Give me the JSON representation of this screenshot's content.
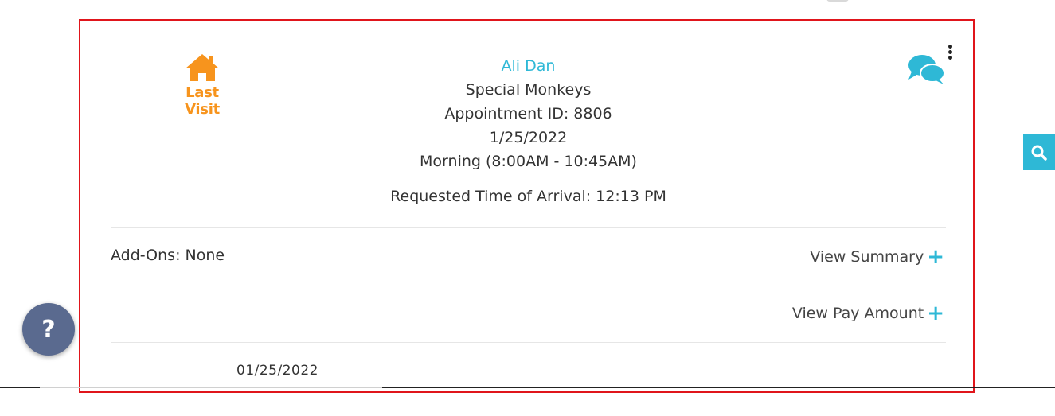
{
  "appointment": {
    "last_visit_label": "Last Visit",
    "client_name": "Ali Dan",
    "pet_name": "Special Monkeys",
    "appointment_id": "Appointment ID: 8806",
    "date": "1/25/2022",
    "time_window": "Morning (8:00AM - 10:45AM)",
    "requested_arrival": "Requested Time of Arrival: 12:13 PM",
    "add_ons": "Add-Ons: None",
    "view_summary_label": "View Summary",
    "view_pay_amount_label": "View Pay Amount",
    "footer_date": "01/25/2022"
  },
  "icons": {
    "last_visit": "house-icon",
    "chat": "chat-bubbles-icon",
    "menu": "kebab-menu-icon",
    "expand": "plus-icon",
    "search": "search-icon",
    "help": "question-mark-icon"
  },
  "help_label": "?",
  "colors": {
    "accent": "#2eb8d6",
    "last_visit": "#f7941d",
    "card_border": "#e0151b",
    "help_button": "#5a6a8f"
  }
}
